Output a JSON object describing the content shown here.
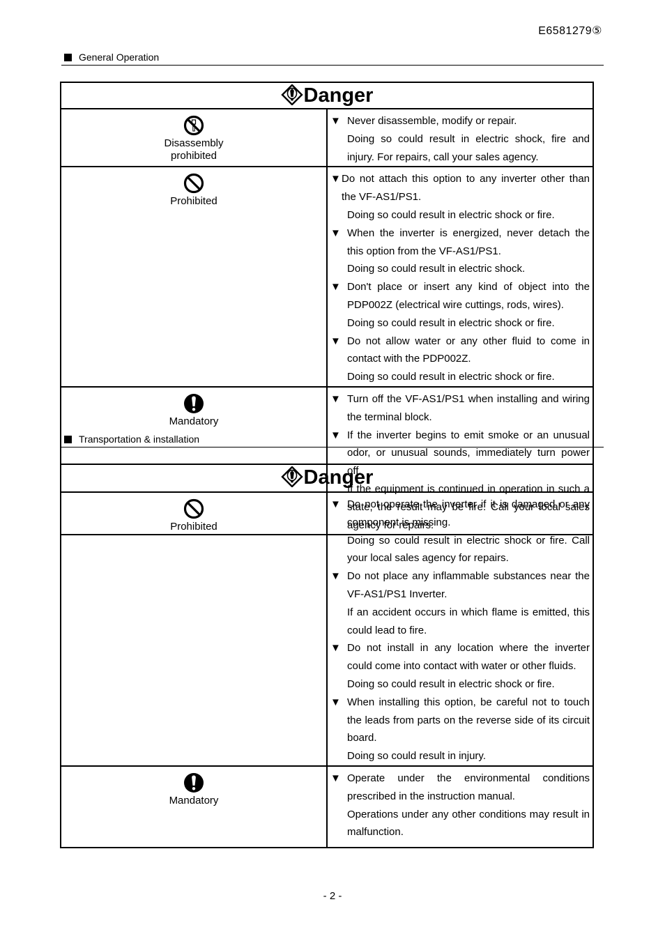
{
  "header": {
    "doc_id": "E6581279⑤"
  },
  "sections": [
    {
      "heading": "General Operation",
      "box_title": "Danger",
      "rows": [
        {
          "icon": "disassembly-prohibited-icon",
          "label_lines": [
            "Disassembly",
            "prohibited"
          ],
          "items": [
            {
              "bullet": "▼",
              "text": "Never disassemble, modify or repair.",
              "details": [
                "Doing so could result in electric shock, fire and injury. For repairs, call your sales agency."
              ]
            }
          ]
        },
        {
          "icon": "prohibited-icon",
          "label_lines": [
            "Prohibited"
          ],
          "items": [
            {
              "bullet": "▼",
              "text": "Do not attach this option to any inverter other than the VF-AS1/PS1.",
              "details": [
                "Doing so could result in electric shock or fire."
              ]
            },
            {
              "bullet": "▼",
              "text": "When the inverter is energized, never detach the this option from the VF-AS1/PS1.",
              "details": [
                "Doing so could result in electric shock."
              ]
            },
            {
              "bullet": "▼",
              "text": "Don't place or insert any kind of object into the PDP002Z (electrical wire cuttings, rods, wires).",
              "details": [
                "Doing so could result in electric shock or fire."
              ]
            },
            {
              "bullet": "▼",
              "text": "Do not allow water or any other fluid to come in contact with the PDP002Z.",
              "details": [
                "Doing so could result in electric shock or fire."
              ]
            }
          ]
        },
        {
          "icon": "mandatory-icon",
          "label_lines": [
            "Mandatory"
          ],
          "items": [
            {
              "bullet": "▼",
              "text": "Turn off the VF-AS1/PS1 when installing and wiring the terminal block.",
              "details": []
            },
            {
              "bullet": "▼",
              "text": "If the inverter begins to emit smoke or an unusual odor, or unusual sounds, immediately turn power off.",
              "details": [
                "If the equipment is continued in operation in such a state, the result may be fire. Call your local sales agency for repairs."
              ]
            }
          ]
        }
      ]
    },
    {
      "heading": "Transportation & installation",
      "box_title": "Danger",
      "rows": [
        {
          "icon": "prohibited-icon",
          "label_lines": [
            "Prohibited"
          ],
          "items": [
            {
              "bullet": "▼",
              "text": "Do not operate the inverter if it is damaged or any component is missing.",
              "details": [
                "Doing so could result in electric shock or fire. Call your local sales agency for repairs."
              ]
            },
            {
              "bullet": "▼",
              "text": "Do not place any inflammable substances near the VF-AS1/PS1 Inverter.",
              "details": [
                "If an accident occurs in which flame is emitted, this could lead to fire."
              ]
            },
            {
              "bullet": "▼",
              "text": "Do not install in any location where the inverter could come into contact with water or other fluids.",
              "details": [
                "Doing so could result in electric shock or fire."
              ]
            },
            {
              "bullet": "▼",
              "text": "When installing this option, be careful not to touch the leads from parts on the reverse side of its circuit board.",
              "details": [
                "Doing so could result in injury."
              ]
            }
          ]
        },
        {
          "icon": "mandatory-icon",
          "label_lines": [
            "Mandatory"
          ],
          "items": [
            {
              "bullet": "▼",
              "text": "Operate under the environmental conditions prescribed in the instruction manual.",
              "details": [
                "Operations under any other conditions may result in malfunction."
              ]
            }
          ]
        }
      ]
    }
  ],
  "footer": {
    "page_number": "- 2 -"
  }
}
